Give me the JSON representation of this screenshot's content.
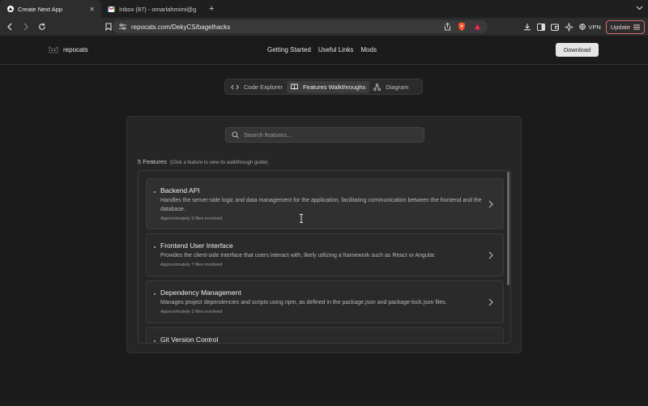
{
  "browser": {
    "tabs": [
      {
        "title": "Create Next App",
        "active": true
      },
      {
        "title": "Inbox (87) - omarlahmimi@gmail...",
        "active": false
      }
    ],
    "url": "repocats.com/DekyCS/bagelhacks",
    "vpn_label": "VPN",
    "update_label": "Update"
  },
  "app": {
    "brand": "repocats",
    "nav": [
      "Getting Started",
      "Useful Links",
      "Mods"
    ],
    "download_label": "Download"
  },
  "segments": [
    {
      "label": "Code Explorer",
      "icon": "code-icon",
      "active": false
    },
    {
      "label": "Features Walkthroughs",
      "icon": "book-icon",
      "active": true
    },
    {
      "label": "Diagram",
      "icon": "diagram-icon",
      "active": false
    }
  ],
  "search": {
    "placeholder": "Search features..."
  },
  "features_header": {
    "count": "5 Features",
    "hint": "(Click a feature to view its walkthrough guide)"
  },
  "features": [
    {
      "name": "Backend API",
      "description": "Handles the server-side logic and data management for the application, facilitating communication between the frontend and the database.",
      "files": "Approximately 5 files involved"
    },
    {
      "name": "Frontend User Interface",
      "description": "Provides the client-side interface that users interact with, likely utilizing a framework such as React or Angular.",
      "files": "Approximately 7 files involved"
    },
    {
      "name": "Dependency Management",
      "description": "Manages project dependencies and scripts using npm, as defined in the package.json and package-lock.json files.",
      "files": "Approximately 2 files involved"
    },
    {
      "name": "Git Version Control",
      "description": "",
      "files": ""
    }
  ]
}
